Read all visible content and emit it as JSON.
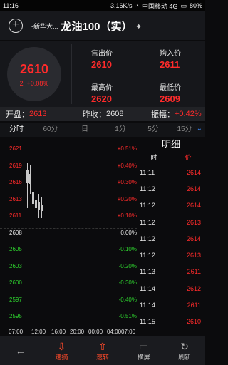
{
  "status": {
    "time": "11:16",
    "speed": "3.16K/s",
    "carrier": "中国移动 4G",
    "battery": "80%"
  },
  "header": {
    "sub": "-新华大...",
    "title": "龙油100（实）",
    "caret": "◆"
  },
  "quote": {
    "price": "2610",
    "change": "2",
    "change_pct": "+0.08%",
    "sell_label": "售出价",
    "sell": "2610",
    "buy_label": "购入价",
    "buy": "2611",
    "high_label": "最高价",
    "high": "2620",
    "low_label": "最低价",
    "low": "2609"
  },
  "openbar": {
    "open_k": "开盘：",
    "open_v": "2613",
    "prev_k": "昨收：",
    "prev_v": "2608",
    "amp_k": "振幅：",
    "amp_v": "+0.42%"
  },
  "tabs": [
    "分时",
    "60分",
    "日",
    "1分",
    "5分",
    "15分"
  ],
  "chart_data": {
    "type": "line",
    "y_left": [
      "2621",
      "2619",
      "2616",
      "2613",
      "2611",
      "2608",
      "2605",
      "2603",
      "2600",
      "2597",
      "2595"
    ],
    "y_right": [
      "+0.51%",
      "+0.40%",
      "+0.30%",
      "+0.20%",
      "+0.10%",
      "0.00%",
      "-0.10%",
      "-0.20%",
      "-0.30%",
      "-0.40%",
      "-0.51%"
    ],
    "x_labels": [
      "07:00",
      "12:00",
      "16:00",
      "20:00",
      "00:00",
      "04:00",
      "07:00"
    ]
  },
  "detail": {
    "title": "明细",
    "col_time": "时",
    "col_price": "价",
    "rows": [
      {
        "t": "11:11",
        "p": "2614"
      },
      {
        "t": "11:12",
        "p": "2614"
      },
      {
        "t": "11:12",
        "p": "2614"
      },
      {
        "t": "11:12",
        "p": "2613"
      },
      {
        "t": "11:12",
        "p": "2614"
      },
      {
        "t": "11:12",
        "p": "2613"
      },
      {
        "t": "11:13",
        "p": "2611"
      },
      {
        "t": "11:14",
        "p": "2612"
      },
      {
        "t": "11:14",
        "p": "2611"
      },
      {
        "t": "11:15",
        "p": "2610"
      }
    ]
  },
  "bottom": {
    "b1": "速摘",
    "b2": "速转",
    "b3": "横屏",
    "b4": "刷新"
  }
}
